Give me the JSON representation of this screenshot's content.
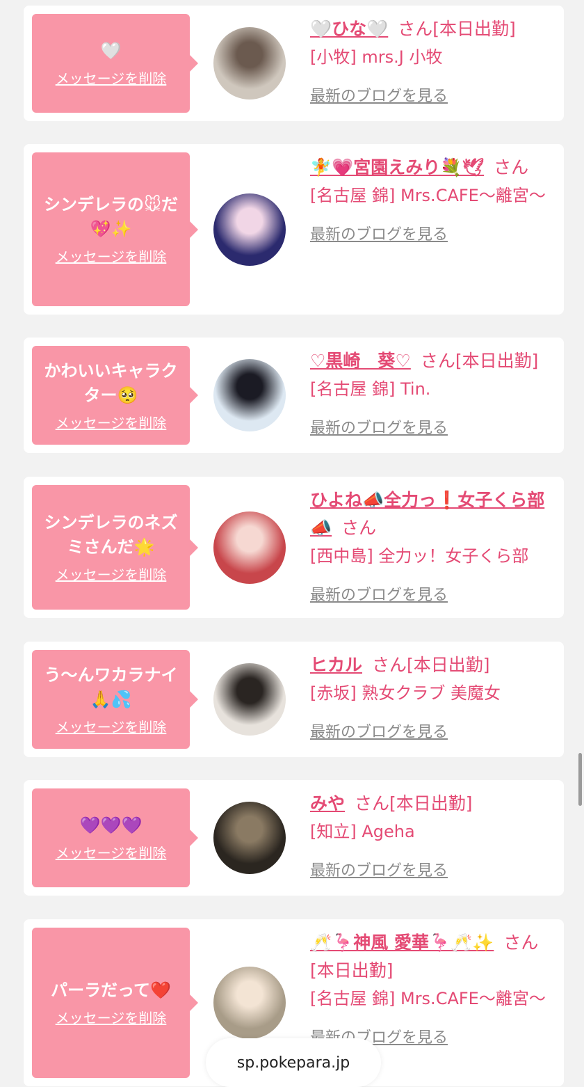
{
  "messages": [
    {
      "message": "🤍",
      "delete_label": "メッセージを削除",
      "name": "🤍ひな🤍",
      "san": "さん",
      "status": "[本日出勤]",
      "shop": "[小牧] mrs.J 小牧",
      "blog_label": "最新のブログを見る",
      "avatar_colors": [
        "#cfc7bd",
        "#6b5a4f"
      ]
    },
    {
      "message": "シンデレラの🐭だ💖✨",
      "delete_label": "メッセージを削除",
      "name": "🧚💗宮園えみり💐🕊",
      "san": "さん",
      "status": "",
      "shop": "[名古屋 錦] Mrs.CAFE～離宮～",
      "blog_label": "最新のブログを見る",
      "avatar_colors": [
        "#2b2a6e",
        "#f1d6e6"
      ]
    },
    {
      "message": "かわいいキャラクター🥺",
      "delete_label": "メッセージを削除",
      "name": "♡黒崎　葵♡",
      "san": "さん",
      "status": "[本日出勤]",
      "shop": "[名古屋 錦] Tin.",
      "blog_label": "最新のブログを見る",
      "avatar_colors": [
        "#dde8f2",
        "#1b1b24"
      ]
    },
    {
      "message": "シンデレラのネズミさんだ🌟",
      "delete_label": "メッセージを削除",
      "name": "ひよね📣全力っ❗女子くら部📣",
      "san": "さん",
      "status": "",
      "shop": "[西中島] 全力ッ！女子くら部",
      "blog_label": "最新のブログを見る",
      "avatar_colors": [
        "#c8464b",
        "#f6d8d2"
      ]
    },
    {
      "message": "う～んワカラナイ🙏💦",
      "delete_label": "メッセージを削除",
      "name": "ヒカル",
      "san": "さん",
      "status": "[本日出勤]",
      "shop": "[赤坂] 熟女クラブ 美魔女",
      "blog_label": "最新のブログを見る",
      "avatar_colors": [
        "#e7e2dc",
        "#2a2522"
      ]
    },
    {
      "message": "💜💜💜",
      "delete_label": "メッセージを削除",
      "name": "みや",
      "san": "さん",
      "status": "[本日出勤]",
      "shop": "[知立] Ageha",
      "blog_label": "最新のブログを見る",
      "avatar_colors": [
        "#2b2620",
        "#8a7a63"
      ]
    },
    {
      "message": "パーラだって❤️",
      "delete_label": "メッセージを削除",
      "name": "🥂🦩神風 愛華🦩🥂✨",
      "san": "さん",
      "status": "[本日出勤]",
      "shop": "[名古屋 錦] Mrs.CAFE～離宮～",
      "blog_label": "最新のブログを見る",
      "avatar_colors": [
        "#a89c88",
        "#f3e4d4"
      ]
    }
  ],
  "browser": {
    "url": "sp.pokepara.jp"
  },
  "colors": {
    "bubble": "#f996a7",
    "name": "#e44a74",
    "link_gray": "#8a8a8a",
    "background": "#f2f2f2"
  }
}
